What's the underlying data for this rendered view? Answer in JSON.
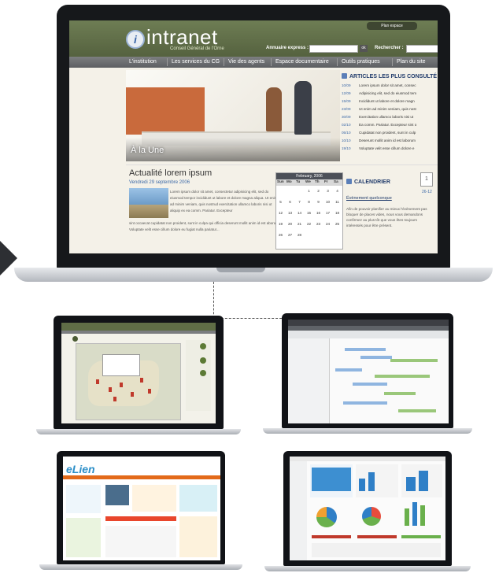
{
  "main": {
    "logo": {
      "text": "intranet",
      "subtitle": "Conseil Général de l'Orne",
      "icon": "info-icon"
    },
    "plan_button": "Plan espace",
    "annuaire_label": "Annuaire express :",
    "ok_label": "ok",
    "search_label": "Rechercher :",
    "nav": [
      "L'institution",
      "Les services du CG",
      "Vie des agents",
      "Espace documentaire",
      "Outils pratiques",
      "Plan du site"
    ],
    "hero_caption": "À la Une",
    "articles": {
      "title": "ARTICLES LES PLUS CONSULTÉ",
      "rows": [
        {
          "date": "10/09",
          "text": "Lorem ipsum dolor sit amet, consec"
        },
        {
          "date": "12/09",
          "text": "Adipisicing elit, sed do eiusmod tem"
        },
        {
          "date": "15/09",
          "text": "Incididunt ut labore et dolore magn"
        },
        {
          "date": "23/09",
          "text": "Ut enim ad minim veniam, quis nost"
        },
        {
          "date": "30/09",
          "text": "Exercitation ullamco laboris nisi ut"
        },
        {
          "date": "02/10",
          "text": "Ea comm. Pariatur. Excepteur sint o"
        },
        {
          "date": "05/10",
          "text": "Cupidatat non proident, sunt in culp"
        },
        {
          "date": "10/10",
          "text": "Deserunt mollit anim id est laborum"
        },
        {
          "date": "19/10",
          "text": "Voluptate velit esse cillum dolore e"
        }
      ]
    },
    "news": {
      "title": "Actualité lorem ipsum",
      "date": "Vendredi 29 septembre 2006",
      "text1": "Lorem ipsum dolor sit amet, consectetur adipisicing elit, sed do eiusmod tempor incididunt ut labore et dolore magna aliqua. Ut enim ad minim veniam, quis nostrud exercitation ullamco laboris nisi ut aliquip ex ea comm. Pariatur. Excepteur",
      "text2": "sint occaecat cupidatat non proident, sunt in culpa qui officia deserunt mollit anim id est aborum. Voluptate velit esse cillum dolore eu fugiat nulla pariatur..."
    },
    "calendar_widget": {
      "month": "February, 2006",
      "days": [
        "Sun",
        "Mo",
        "Tu",
        "We",
        "Th",
        "Fr",
        "Sa"
      ],
      "weeks": [
        [
          "",
          "",
          "",
          "1",
          "2",
          "3",
          "4"
        ],
        [
          "5",
          "6",
          "7",
          "8",
          "9",
          "10",
          "11"
        ],
        [
          "12",
          "13",
          "14",
          "15",
          "16",
          "17",
          "18"
        ],
        [
          "19",
          "20",
          "21",
          "22",
          "23",
          "24",
          "25"
        ],
        [
          "26",
          "27",
          "28",
          "",
          "",
          "",
          ""
        ]
      ]
    },
    "agenda": {
      "title": "CALENDRIER",
      "day_number": "1",
      "date": "26-12",
      "event_title": "Évènement quelconque",
      "event_text": "Afin de pouvoir planifier au mieux l'évènement pas bloquer de places vides, nous vous demandons confirmez au plus tôt que vous êtes toujours intéressés pour être présent."
    }
  },
  "thumbnails": {
    "elien_logo": "eLien"
  },
  "colors": {
    "header_green": "#5f6d46",
    "nav_gray": "#6b6d70",
    "link_blue": "#3d6aa8",
    "laptop_bezel": "#16181b"
  }
}
